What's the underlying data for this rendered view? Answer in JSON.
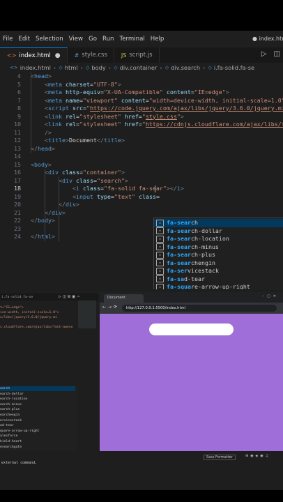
{
  "menubar": {
    "items": [
      "File",
      "Edit",
      "Selection",
      "View",
      "Go",
      "Run",
      "Terminal",
      "Help"
    ],
    "window_title": "● index.htm"
  },
  "tabs": [
    {
      "label": "index.html",
      "icon": "html-icon",
      "modified": "●"
    },
    {
      "label": "style.css",
      "icon": "css-icon"
    },
    {
      "label": "script.js",
      "icon": "js-icon"
    }
  ],
  "breadcrumb": [
    "index.html",
    "html",
    "body",
    "div.container",
    "div.search",
    "i.fa-solid.fa-se"
  ],
  "code_lines": [
    {
      "n": "4",
      "frag": [
        [
          "br",
          "<"
        ],
        [
          "tag",
          "head"
        ],
        [
          "br",
          ">"
        ]
      ],
      "indent": 2
    },
    {
      "n": "5",
      "frag": [
        [
          "br",
          "<"
        ],
        [
          "tag",
          "meta"
        ],
        [
          "pl",
          " "
        ],
        [
          "at",
          "charset"
        ],
        [
          "pl",
          "="
        ],
        [
          "st",
          "\"UTF-8\""
        ],
        [
          "br",
          ">"
        ]
      ],
      "indent": 4
    },
    {
      "n": "6",
      "frag": [
        [
          "br",
          "<"
        ],
        [
          "tag",
          "meta"
        ],
        [
          "pl",
          " "
        ],
        [
          "at",
          "http-equiv"
        ],
        [
          "pl",
          "="
        ],
        [
          "st",
          "\"X-UA-Compatible\""
        ],
        [
          "pl",
          " "
        ],
        [
          "at",
          "content"
        ],
        [
          "pl",
          "="
        ],
        [
          "st",
          "\"IE=edge\""
        ],
        [
          "br",
          ">"
        ]
      ],
      "indent": 4
    },
    {
      "n": "7",
      "frag": [
        [
          "br",
          "<"
        ],
        [
          "tag",
          "meta"
        ],
        [
          "pl",
          " "
        ],
        [
          "at",
          "name"
        ],
        [
          "pl",
          "="
        ],
        [
          "st",
          "\"viewport\""
        ],
        [
          "pl",
          " "
        ],
        [
          "at",
          "content"
        ],
        [
          "pl",
          "="
        ],
        [
          "st",
          "\"width=device-width, initial-scale=1.0\""
        ],
        [
          "br",
          ">"
        ]
      ],
      "indent": 4
    },
    {
      "n": "8",
      "frag": [
        [
          "br",
          "<"
        ],
        [
          "tag",
          "script"
        ],
        [
          "pl",
          " "
        ],
        [
          "at",
          "src"
        ],
        [
          "pl",
          "="
        ],
        [
          "st",
          "\""
        ],
        [
          "lk",
          "https://code.jquery.com/ajax/libs/jquery/3.6.0/jquery.mi"
        ]
      ],
      "indent": 4
    },
    {
      "n": "9",
      "frag": [
        [
          "br",
          "<"
        ],
        [
          "tag",
          "link"
        ],
        [
          "pl",
          " "
        ],
        [
          "at",
          "rel"
        ],
        [
          "pl",
          "="
        ],
        [
          "st",
          "\"stylesheet\""
        ],
        [
          "pl",
          " "
        ],
        [
          "at",
          "href"
        ],
        [
          "pl",
          "="
        ],
        [
          "st",
          "\""
        ],
        [
          "lk",
          "style.css"
        ],
        [
          "st",
          "\""
        ],
        [
          "br",
          ">"
        ]
      ],
      "indent": 4
    },
    {
      "n": "10",
      "frag": [
        [
          "br",
          "<"
        ],
        [
          "tag",
          "link"
        ],
        [
          "pl",
          " "
        ],
        [
          "at",
          "rel"
        ],
        [
          "pl",
          "="
        ],
        [
          "st",
          "\"stylesheet\""
        ],
        [
          "pl",
          " "
        ],
        [
          "at",
          "href"
        ],
        [
          "pl",
          "="
        ],
        [
          "st",
          "\""
        ],
        [
          "lk",
          "https://cdnjs.cloudflare.com/ajax/libs/font-a"
        ]
      ],
      "indent": 4
    },
    {
      "n": "11",
      "frag": [
        [
          "br",
          "/>"
        ]
      ],
      "indent": 4
    },
    {
      "n": "12",
      "frag": [
        [
          "br",
          "<"
        ],
        [
          "tag",
          "title"
        ],
        [
          "br",
          ">"
        ],
        [
          "pl",
          "Document"
        ],
        [
          "br",
          "</"
        ],
        [
          "tag",
          "title"
        ],
        [
          "br",
          ">"
        ]
      ],
      "indent": 4
    },
    {
      "n": "13",
      "frag": [
        [
          "br",
          "</"
        ],
        [
          "tag",
          "head"
        ],
        [
          "br",
          ">"
        ]
      ],
      "indent": 2
    },
    {
      "n": "14",
      "frag": [],
      "indent": 0
    },
    {
      "n": "15",
      "frag": [
        [
          "br",
          "<"
        ],
        [
          "tag",
          "body"
        ],
        [
          "br",
          ">"
        ]
      ],
      "indent": 2
    },
    {
      "n": "16",
      "frag": [
        [
          "br",
          "<"
        ],
        [
          "tag",
          "div"
        ],
        [
          "pl",
          " "
        ],
        [
          "at",
          "class"
        ],
        [
          "pl",
          "="
        ],
        [
          "st",
          "\"container\""
        ],
        [
          "br",
          ">"
        ]
      ],
      "indent": 4
    },
    {
      "n": "17",
      "frag": [
        [
          "br",
          "<"
        ],
        [
          "tag",
          "div"
        ],
        [
          "pl",
          " "
        ],
        [
          "at",
          "class"
        ],
        [
          "pl",
          "="
        ],
        [
          "st",
          "\"search\""
        ],
        [
          "br",
          ">"
        ]
      ],
      "indent": 6
    },
    {
      "n": "18",
      "frag": [
        [
          "br",
          "<"
        ],
        [
          "tag",
          "i"
        ],
        [
          "pl",
          " "
        ],
        [
          "at",
          "class"
        ],
        [
          "pl",
          "="
        ],
        [
          "st",
          "\"fa-solid fa-sear"
        ],
        [
          "st",
          "\""
        ],
        [
          "br",
          "></"
        ],
        [
          "tag",
          "i"
        ],
        [
          "br",
          ">"
        ]
      ],
      "indent": 8,
      "current": true
    },
    {
      "n": "19",
      "frag": [
        [
          "br",
          "<"
        ],
        [
          "tag",
          "input"
        ],
        [
          "pl",
          " "
        ],
        [
          "at",
          "type"
        ],
        [
          "pl",
          "="
        ],
        [
          "st",
          "\"text\""
        ],
        [
          "pl",
          " "
        ],
        [
          "at",
          "class"
        ],
        [
          "pl",
          "="
        ]
      ],
      "indent": 8
    },
    {
      "n": "20",
      "frag": [
        [
          "br",
          "</"
        ],
        [
          "tag",
          "div"
        ],
        [
          "br",
          ">"
        ]
      ],
      "indent": 6
    },
    {
      "n": "21",
      "frag": [
        [
          "br",
          "</"
        ],
        [
          "tag",
          "div"
        ],
        [
          "br",
          ">"
        ]
      ],
      "indent": 4
    },
    {
      "n": "22",
      "frag": [
        [
          "br",
          "</"
        ],
        [
          "tag",
          "body"
        ],
        [
          "br",
          ">"
        ]
      ],
      "indent": 2
    },
    {
      "n": "23",
      "frag": [],
      "indent": 0
    },
    {
      "n": "24",
      "frag": [
        [
          "br",
          "</"
        ],
        [
          "tag",
          "html"
        ],
        [
          "br",
          ">"
        ]
      ],
      "indent": 2
    }
  ],
  "autocomplete": [
    {
      "match": "fa-sear",
      "rest": "ch"
    },
    {
      "match": "fa-sear",
      "rest": "ch-dollar"
    },
    {
      "match": "fa-sear",
      "rest": "ch-location"
    },
    {
      "match": "fa-sear",
      "rest": "ch-minus"
    },
    {
      "match": "fa-sear",
      "rest": "ch-plus"
    },
    {
      "match": "fa-sear",
      "rest": "chengin"
    },
    {
      "match": "fa-ser",
      "rest": "vicestack"
    },
    {
      "match": "fa-sa",
      "rest": "d-tear"
    },
    {
      "match": "fa-squa",
      "rest": "re-arrow-up-right"
    },
    {
      "match": "fa-s",
      "rest": "alesforce"
    },
    {
      "match": "fa-s",
      "rest": "hield-heart"
    },
    {
      "match": "fa-rese",
      "rest": "archgate"
    }
  ],
  "lower_left": {
    "title": "i.fa-solid.fa-se",
    "code": [
      "t=\"IE=edge\">",
      "ice-width, initial-scale=1.0\">",
      "x/libs/jquery/3.6.0/jquery.mi",
      "",
      "s.cloudflare.com/ajax/libs/font-aweso"
    ],
    "suggestions": [
      "earch",
      "earch-dollar",
      "earch-location",
      "earch-minus",
      "earch-plus",
      "earchengin",
      "ervicestack",
      "ad-tear",
      "quare-arrow-up-right",
      "alesforce",
      "hield-heart",
      "esearchgate"
    ],
    "terminal": "external command,"
  },
  "browser": {
    "tab_title": "Document",
    "url": "http://127.0.0.1:5500/index.html",
    "page_color": "#a06ed8"
  },
  "status": {
    "formatter": "Sass Formatter"
  }
}
